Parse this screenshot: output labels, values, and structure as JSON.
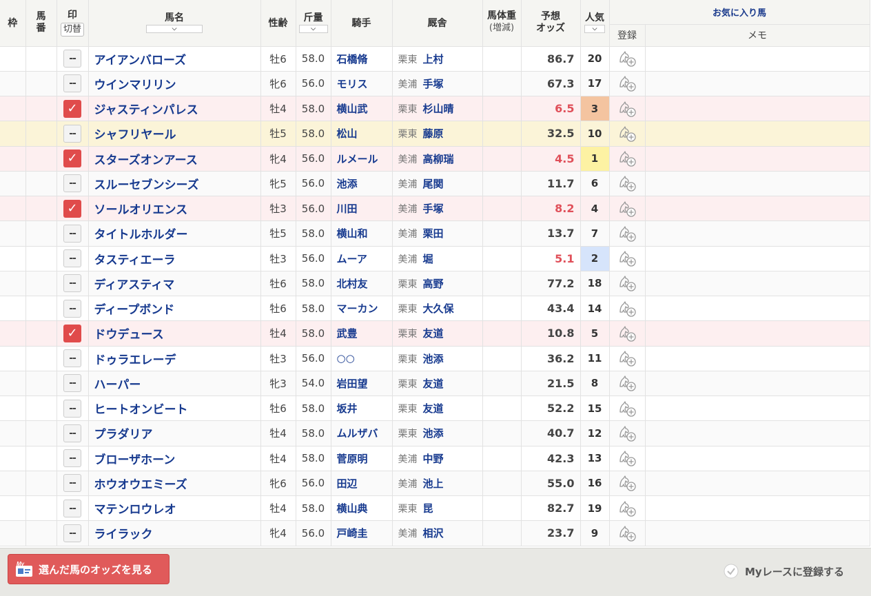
{
  "headers": {
    "waku": "枠",
    "umaban": "馬番",
    "mark": "印",
    "mark_switch": "切替",
    "name": "馬名",
    "sex_age": "性齢",
    "weight": "斤量",
    "jockey": "騎手",
    "stable": "厩舎",
    "body_weight": "馬体重",
    "body_weight_sub": "(増減)",
    "odds_line1": "予想",
    "odds_line2": "オッズ",
    "popularity": "人気",
    "favorites": "お気に入り馬",
    "register": "登録",
    "memo": "メモ",
    "sort_arrow": "⌵"
  },
  "rows": [
    {
      "marked": false,
      "name": "アイアンバローズ",
      "sex_age": "牡6",
      "weight": "58.0",
      "jockey": "石橋脩",
      "region": "栗東",
      "trainer": "上村",
      "odds": "86.7",
      "pop": "20"
    },
    {
      "marked": false,
      "name": "ウインマリリン",
      "sex_age": "牝6",
      "weight": "56.0",
      "jockey": "モリス",
      "region": "美浦",
      "trainer": "手塚",
      "odds": "67.3",
      "pop": "17"
    },
    {
      "marked": true,
      "name": "ジャスティンパレス",
      "sex_age": "牡4",
      "weight": "58.0",
      "jockey": "横山武",
      "region": "栗東",
      "trainer": "杉山晴",
      "odds": "6.5",
      "pop": "3"
    },
    {
      "marked": false,
      "highlight": true,
      "name": "シャフリヤール",
      "sex_age": "牡5",
      "weight": "58.0",
      "jockey": "松山",
      "region": "栗東",
      "trainer": "藤原",
      "odds": "32.5",
      "pop": "10"
    },
    {
      "marked": true,
      "name": "スターズオンアース",
      "sex_age": "牝4",
      "weight": "56.0",
      "jockey": "ルメール",
      "region": "美浦",
      "trainer": "高柳瑞",
      "odds": "4.5",
      "pop": "1"
    },
    {
      "marked": false,
      "name": "スルーセブンシーズ",
      "sex_age": "牝5",
      "weight": "56.0",
      "jockey": "池添",
      "region": "美浦",
      "trainer": "尾関",
      "odds": "11.7",
      "pop": "6"
    },
    {
      "marked": true,
      "name": "ソールオリエンス",
      "sex_age": "牡3",
      "weight": "56.0",
      "jockey": "川田",
      "region": "美浦",
      "trainer": "手塚",
      "odds": "8.2",
      "pop": "4"
    },
    {
      "marked": false,
      "name": "タイトルホルダー",
      "sex_age": "牡5",
      "weight": "58.0",
      "jockey": "横山和",
      "region": "美浦",
      "trainer": "栗田",
      "odds": "13.7",
      "pop": "7"
    },
    {
      "marked": false,
      "name": "タスティエーラ",
      "sex_age": "牡3",
      "weight": "56.0",
      "jockey": "ムーア",
      "region": "美浦",
      "trainer": "堀",
      "odds": "5.1",
      "pop": "2"
    },
    {
      "marked": false,
      "name": "ディアスティマ",
      "sex_age": "牡6",
      "weight": "58.0",
      "jockey": "北村友",
      "region": "栗東",
      "trainer": "高野",
      "odds": "77.2",
      "pop": "18"
    },
    {
      "marked": false,
      "name": "ディープボンド",
      "sex_age": "牡6",
      "weight": "58.0",
      "jockey": "マーカン",
      "region": "栗東",
      "trainer": "大久保",
      "odds": "43.4",
      "pop": "14"
    },
    {
      "marked": true,
      "name": "ドウデュース",
      "sex_age": "牡4",
      "weight": "58.0",
      "jockey": "武豊",
      "region": "栗東",
      "trainer": "友道",
      "odds": "10.8",
      "pop": "5"
    },
    {
      "marked": false,
      "name": "ドゥラエレーデ",
      "sex_age": "牡3",
      "weight": "56.0",
      "jockey": "○○",
      "region": "栗東",
      "trainer": "池添",
      "odds": "36.2",
      "pop": "11"
    },
    {
      "marked": false,
      "name": "ハーパー",
      "sex_age": "牝3",
      "weight": "54.0",
      "jockey": "岩田望",
      "region": "栗東",
      "trainer": "友道",
      "odds": "21.5",
      "pop": "8"
    },
    {
      "marked": false,
      "name": "ヒートオンビート",
      "sex_age": "牡6",
      "weight": "58.0",
      "jockey": "坂井",
      "region": "栗東",
      "trainer": "友道",
      "odds": "52.2",
      "pop": "15"
    },
    {
      "marked": false,
      "name": "プラダリア",
      "sex_age": "牡4",
      "weight": "58.0",
      "jockey": "ムルザバ",
      "region": "栗東",
      "trainer": "池添",
      "odds": "40.7",
      "pop": "12"
    },
    {
      "marked": false,
      "name": "ブローザホーン",
      "sex_age": "牡4",
      "weight": "58.0",
      "jockey": "菅原明",
      "region": "美浦",
      "trainer": "中野",
      "odds": "42.3",
      "pop": "13"
    },
    {
      "marked": false,
      "name": "ホウオウエミーズ",
      "sex_age": "牝6",
      "weight": "56.0",
      "jockey": "田辺",
      "region": "美浦",
      "trainer": "池上",
      "odds": "55.0",
      "pop": "16"
    },
    {
      "marked": false,
      "name": "マテンロウレオ",
      "sex_age": "牡4",
      "weight": "58.0",
      "jockey": "横山典",
      "region": "栗東",
      "trainer": "昆",
      "odds": "82.7",
      "pop": "19"
    },
    {
      "marked": false,
      "name": "ライラック",
      "sex_age": "牝4",
      "weight": "56.0",
      "jockey": "戸崎圭",
      "region": "美浦",
      "trainer": "相沢",
      "odds": "23.7",
      "pop": "9"
    }
  ],
  "mark_empty_label": "--",
  "mark_checked_label": "✓",
  "footer": {
    "odds_button": "選んだ馬のオッズを見る",
    "my_badge": "My",
    "register_race": "Myレースに登録する"
  },
  "colors": {
    "accent_red": "#e05a5a",
    "link_blue": "#173a8f",
    "low_odds": "#e0505a",
    "pop1": "#fdf2a3",
    "pop2": "#d6e4fb",
    "pop3": "#f4c4a0"
  }
}
